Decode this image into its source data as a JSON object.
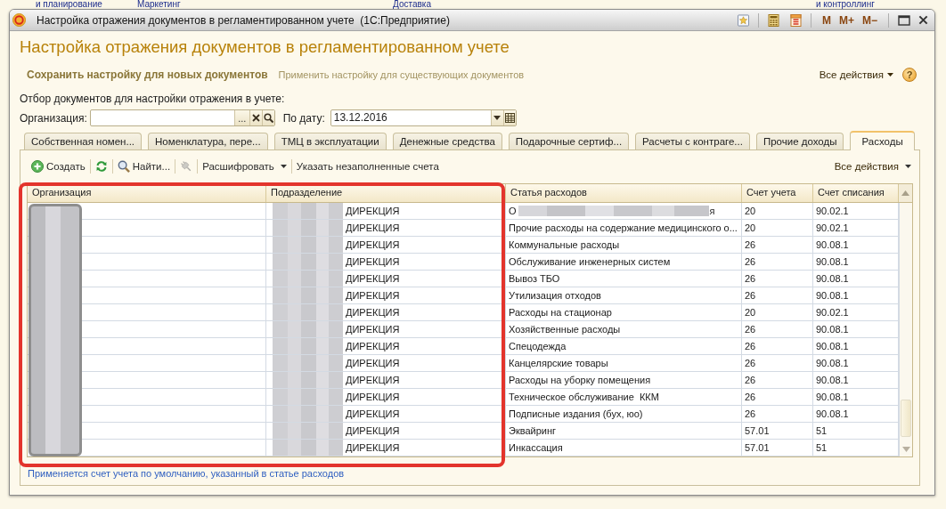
{
  "background_app": {
    "menu_items": [
      "и планирование",
      "Маркетинг",
      "Доставка",
      "и контроллинг"
    ]
  },
  "window": {
    "title": "Настройка отражения документов в регламентированном учете  (1С:Предприятие)",
    "memory_buttons": [
      "M",
      "M+",
      "M−"
    ]
  },
  "form": {
    "heading": "Настройка отражения документов в регламентированном учете",
    "commands": [
      {
        "kind": "primary",
        "label": "Сохранить настройку для новых документов"
      },
      {
        "kind": "secondary",
        "label": "Применить настройку для существующих документов"
      }
    ],
    "all_actions": "Все действия",
    "help_button": "?",
    "filter_caption": "Отбор документов для настройки отражения в учете:",
    "organization": {
      "label": "Организация:",
      "select_button": "..."
    },
    "date": {
      "label": "По дату:",
      "value": "13.12.2016"
    }
  },
  "tabs": [
    {
      "label": "Собственная номен...",
      "selected": false
    },
    {
      "label": "Номенклатура, пере...",
      "selected": false
    },
    {
      "label": "ТМЦ в эксплуатации",
      "selected": false
    },
    {
      "label": "Денежные средства",
      "selected": false
    },
    {
      "label": "Подарочные сертиф...",
      "selected": false
    },
    {
      "label": "Расчеты с контраге...",
      "selected": false
    },
    {
      "label": "Прочие доходы",
      "selected": false
    },
    {
      "label": "Расходы",
      "selected": true
    }
  ],
  "toolbar": {
    "items": [
      {
        "kind": "create",
        "label": "Создать",
        "disabled": false
      },
      {
        "kind": "refresh",
        "disabled": false
      },
      {
        "kind": "find",
        "label": "Найти...",
        "disabled": false
      },
      {
        "kind": "unlink",
        "disabled": true
      },
      {
        "kind": "menu",
        "label": "Расшифровать",
        "disabled": false
      },
      {
        "kind": "text",
        "label": "Указать незаполненные счета",
        "disabled": false
      }
    ],
    "all_actions": "Все действия"
  },
  "table": {
    "columns": [
      "Организация",
      "Подразделение",
      "Статья расходов",
      "Счет учета",
      "Счет списания"
    ],
    "rows": [
      {
        "department": "ДИРЕКЦИЯ",
        "expense_item": "О",
        "expense_item_redacted": true,
        "expense_item_end": "я",
        "account": "20",
        "write_off_account": "90.02.1"
      },
      {
        "department": "ДИРЕКЦИЯ",
        "expense_item": "Прочие расходы на содержание медицинского о...",
        "expense_item_redacted": false,
        "account": "20",
        "write_off_account": "90.02.1"
      },
      {
        "department": "ДИРЕКЦИЯ",
        "expense_item": "Коммунальные расходы",
        "expense_item_redacted": false,
        "account": "26",
        "write_off_account": "90.08.1"
      },
      {
        "department": "ДИРЕКЦИЯ",
        "expense_item": "Обслуживание инженерных систем",
        "expense_item_redacted": false,
        "account": "26",
        "write_off_account": "90.08.1"
      },
      {
        "department": "ДИРЕКЦИЯ",
        "expense_item": "Вывоз ТБО",
        "expense_item_redacted": false,
        "account": "26",
        "write_off_account": "90.08.1"
      },
      {
        "department": "ДИРЕКЦИЯ",
        "expense_item": "Утилизация отходов",
        "expense_item_redacted": false,
        "account": "26",
        "write_off_account": "90.08.1"
      },
      {
        "department": "ДИРЕКЦИЯ",
        "expense_item": "Расходы на стационар",
        "expense_item_redacted": false,
        "account": "20",
        "write_off_account": "90.02.1"
      },
      {
        "department": "ДИРЕКЦИЯ",
        "expense_item": "Хозяйственные расходы",
        "expense_item_redacted": false,
        "account": "26",
        "write_off_account": "90.08.1"
      },
      {
        "department": "ДИРЕКЦИЯ",
        "expense_item": "Спецодежда",
        "expense_item_redacted": false,
        "account": "26",
        "write_off_account": "90.08.1"
      },
      {
        "department": "ДИРЕКЦИЯ",
        "expense_item": "Канцелярские товары",
        "expense_item_redacted": false,
        "account": "26",
        "write_off_account": "90.08.1"
      },
      {
        "department": "ДИРЕКЦИЯ",
        "expense_item": "Расходы на уборку помещения",
        "expense_item_redacted": false,
        "account": "26",
        "write_off_account": "90.08.1"
      },
      {
        "department": "ДИРЕКЦИЯ",
        "expense_item": "Техническое обслуживание  ККМ",
        "expense_item_redacted": false,
        "account": "26",
        "write_off_account": "90.08.1"
      },
      {
        "department": "ДИРЕКЦИЯ",
        "expense_item": "Подписные издания (бух, юо)",
        "expense_item_redacted": false,
        "account": "26",
        "write_off_account": "90.08.1"
      },
      {
        "department": "ДИРЕКЦИЯ",
        "expense_item": "Эквайринг",
        "expense_item_redacted": false,
        "account": "57.01",
        "write_off_account": "51"
      },
      {
        "department": "ДИРЕКЦИЯ",
        "expense_item": "Инкассация",
        "expense_item_redacted": false,
        "account": "57.01",
        "write_off_account": "51"
      }
    ]
  },
  "hint": "Применяется счет учета по умолчанию, указанный в статье расходов"
}
